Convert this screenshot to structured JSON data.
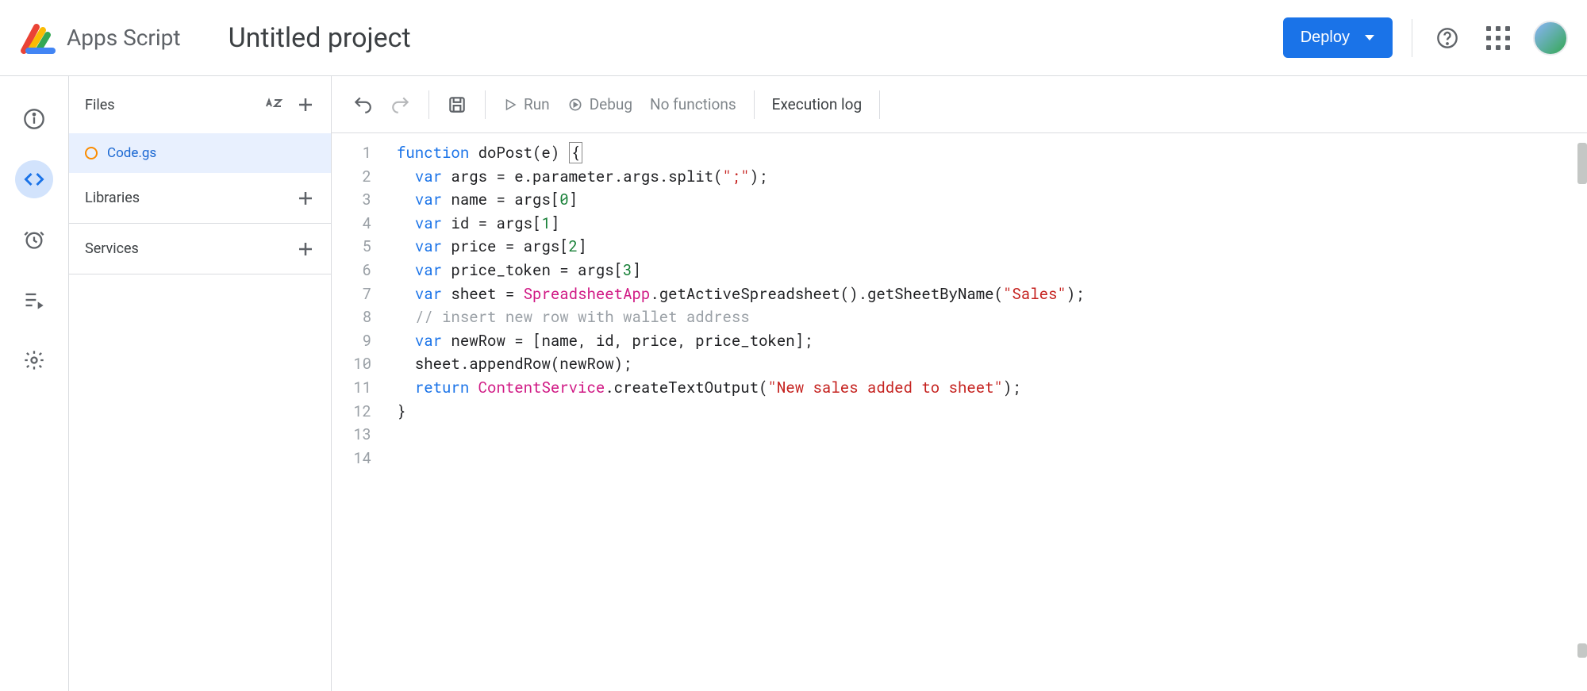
{
  "header": {
    "app_name": "Apps Script",
    "project_title": "Untitled project",
    "deploy_label": "Deploy"
  },
  "sidebar": {
    "files_label": "Files",
    "file_name": "Code.gs",
    "libraries_label": "Libraries",
    "services_label": "Services"
  },
  "toolbar": {
    "run_label": "Run",
    "debug_label": "Debug",
    "functions_label": "No functions",
    "execution_log_label": "Execution log"
  },
  "code": {
    "line_count": 14,
    "lines": [
      {
        "n": 1,
        "tokens": [
          [
            "kw",
            "function"
          ],
          [
            "",
            " doPost(e) "
          ],
          [
            "curs",
            "{"
          ]
        ]
      },
      {
        "n": 2,
        "tokens": [
          [
            "",
            "  "
          ],
          [
            "kw",
            "var"
          ],
          [
            "",
            " args = e.parameter.args.split("
          ],
          [
            "str",
            "\";\""
          ],
          [
            "",
            ");"
          ]
        ]
      },
      {
        "n": 3,
        "tokens": [
          [
            "",
            "  "
          ],
          [
            "kw",
            "var"
          ],
          [
            "",
            " name = args["
          ],
          [
            "num",
            "0"
          ],
          [
            "",
            "]"
          ]
        ]
      },
      {
        "n": 4,
        "tokens": [
          [
            "",
            "  "
          ],
          [
            "kw",
            "var"
          ],
          [
            "",
            " id = args["
          ],
          [
            "num",
            "1"
          ],
          [
            "",
            "]"
          ]
        ]
      },
      {
        "n": 5,
        "tokens": [
          [
            "",
            "  "
          ],
          [
            "kw",
            "var"
          ],
          [
            "",
            " price = args["
          ],
          [
            "num",
            "2"
          ],
          [
            "",
            "]"
          ]
        ]
      },
      {
        "n": 6,
        "tokens": [
          [
            "",
            "  "
          ],
          [
            "kw",
            "var"
          ],
          [
            "",
            " price_token = args["
          ],
          [
            "num",
            "3"
          ],
          [
            "",
            "]"
          ]
        ]
      },
      {
        "n": 7,
        "tokens": [
          [
            "",
            ""
          ]
        ]
      },
      {
        "n": 8,
        "tokens": [
          [
            "",
            "  "
          ],
          [
            "kw",
            "var"
          ],
          [
            "",
            " sheet = "
          ],
          [
            "cls2",
            "SpreadsheetApp"
          ],
          [
            "",
            ".getActiveSpreadsheet().getSheetByName("
          ],
          [
            "str",
            "\"Sales\""
          ],
          [
            "",
            ");"
          ]
        ]
      },
      {
        "n": 9,
        "tokens": [
          [
            "",
            ""
          ]
        ]
      },
      {
        "n": 10,
        "tokens": [
          [
            "",
            "  "
          ],
          [
            "cmt",
            "// insert new row with wallet address"
          ]
        ]
      },
      {
        "n": 11,
        "tokens": [
          [
            "",
            "  "
          ],
          [
            "kw",
            "var"
          ],
          [
            "",
            " newRow = [name, id, price, price_token];"
          ]
        ]
      },
      {
        "n": 12,
        "tokens": [
          [
            "",
            "  sheet.appendRow(newRow);"
          ]
        ]
      },
      {
        "n": 13,
        "tokens": [
          [
            "",
            "  "
          ],
          [
            "kw",
            "return"
          ],
          [
            "",
            " "
          ],
          [
            "cls2",
            "ContentService"
          ],
          [
            "",
            ".createTextOutput("
          ],
          [
            "str",
            "\"New sales added to sheet\""
          ],
          [
            "",
            ");"
          ]
        ]
      },
      {
        "n": 14,
        "tokens": [
          [
            "",
            "}"
          ]
        ]
      }
    ]
  }
}
